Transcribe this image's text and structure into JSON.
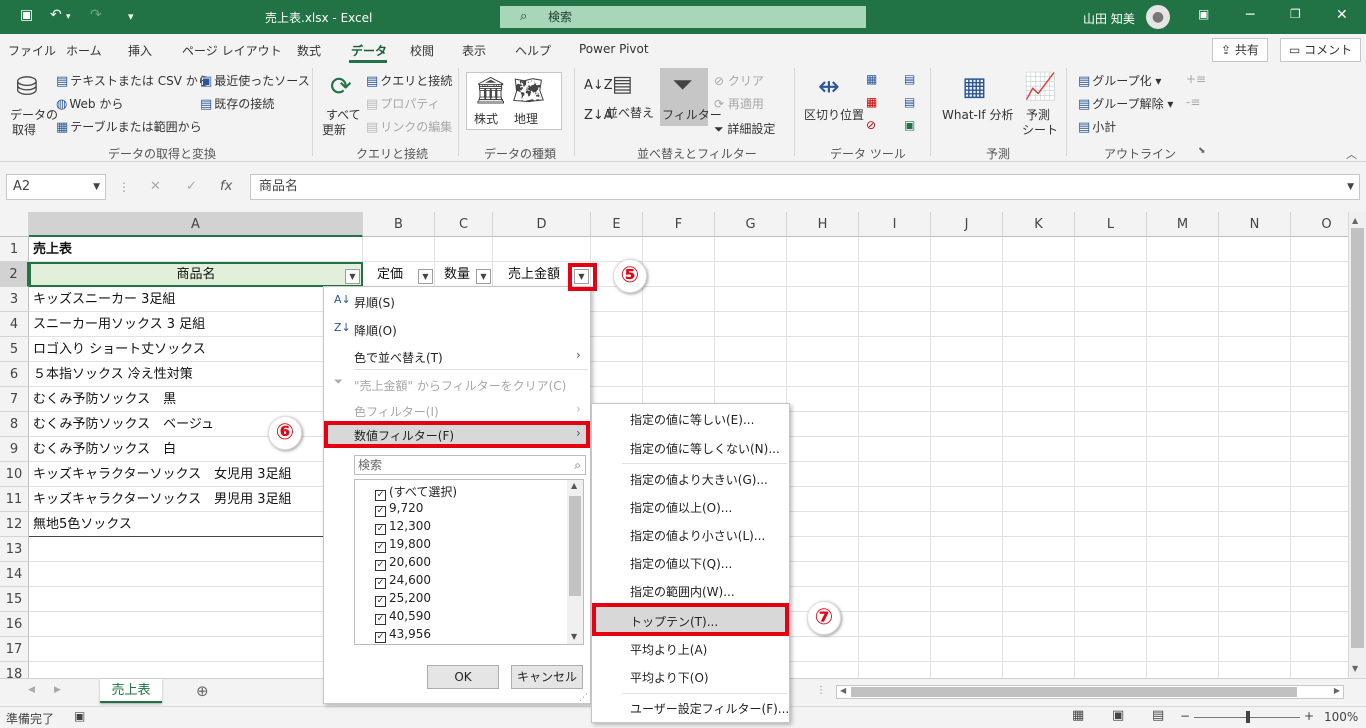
{
  "window": {
    "title": "売上表.xlsx  -  Excel",
    "search_placeholder": "検索",
    "user": "山田 知美"
  },
  "menu": {
    "tabs": [
      "ファイル",
      "ホーム",
      "挿入",
      "ページ レイアウト",
      "数式",
      "データ",
      "校閲",
      "表示",
      "ヘルプ",
      "Power Pivot"
    ],
    "share": "共有",
    "comment": "コメント"
  },
  "ribbon": {
    "get_data": "データの",
    "get_data2": "取得",
    "from_text": "テキストまたは CSV から",
    "from_web": "Web から",
    "from_table": "テーブルまたは範囲から",
    "recent": "最近使ったソース",
    "existing": "既存の接続",
    "group1": "データの取得と変換",
    "refresh1": "すべて",
    "refresh2": "更新",
    "queries": "クエリと接続",
    "properties": "プロパティ",
    "edit_links": "リンクの編集",
    "group2": "クエリと接続",
    "stocks": "株式",
    "geo": "地理",
    "group3": "データの種類",
    "sort": "並べ替え",
    "filter": "フィルター",
    "clear": "クリア",
    "reapply": "再適用",
    "advanced": "詳細設定",
    "group4": "並べ替えとフィルター",
    "split": "区切り位置",
    "group5": "データ ツール",
    "whatif": "What-If 分析",
    "forecast1": "予測",
    "forecast2": "シート",
    "group6": "予測",
    "group_btn": "グループ化",
    "ungroup": "グループ解除",
    "subtotal": "小計",
    "group7": "アウトライン"
  },
  "formula_bar": {
    "cell_ref": "A2",
    "content": "商品名"
  },
  "columns": [
    "A",
    "B",
    "C",
    "D",
    "E",
    "F",
    "G",
    "H",
    "I",
    "J",
    "K",
    "L",
    "M",
    "N",
    "O"
  ],
  "rows": [
    "1",
    "2",
    "3",
    "4",
    "5",
    "6",
    "7",
    "8",
    "9",
    "10",
    "11",
    "12",
    "13",
    "14",
    "15",
    "16",
    "17",
    "18"
  ],
  "cells": {
    "title": "売上表",
    "headers": [
      "商品名",
      "定価",
      "数量",
      "売上金額"
    ],
    "products": [
      "キッズスニーカー 3足組",
      "スニーカー用ソックス 3 足組",
      "ロゴ入り ショート丈ソックス",
      "５本指ソックス 冷え性対策",
      "むくみ予防ソックス　黒",
      "むくみ予防ソックス　ベージュ",
      "むくみ予防ソックス　白",
      "キッズキャラクターソックス　女児用 3足組",
      "キッズキャラクターソックス　男児用 3足組",
      "無地5色ソックス"
    ]
  },
  "dropdown": {
    "sort_asc": "昇順(S)",
    "sort_desc": "降順(O)",
    "sort_color": "色で並べ替え(T)",
    "clear_filter": "\"売上金額\" からフィルターをクリア(C)",
    "color_filter": "色フィルター(I)",
    "number_filter": "数値フィルター(F)",
    "search_placeholder": "検索",
    "values": [
      "(すべて選択)",
      "9,720",
      "12,300",
      "19,800",
      "20,600",
      "24,600",
      "25,200",
      "40,590",
      "43,956"
    ],
    "ok": "OK",
    "cancel": "キャンセル"
  },
  "submenu": {
    "items": [
      "指定の値に等しい(E)...",
      "指定の値に等しくない(N)...",
      "指定の値より大きい(G)...",
      "指定の値以上(O)...",
      "指定の値より小さい(L)...",
      "指定の値以下(Q)...",
      "指定の範囲内(W)...",
      "トップテン(T)...",
      "平均より上(A)",
      "平均より下(O)",
      "ユーザー設定フィルター(F)..."
    ]
  },
  "callouts": [
    "⑤",
    "⑥",
    "⑦"
  ],
  "sheet": {
    "tab": "売上表"
  },
  "status": {
    "ready": "準備完了",
    "zoom": "100%"
  },
  "colors": {
    "excel_green": "#217346",
    "highlight_red": "#e60012"
  }
}
